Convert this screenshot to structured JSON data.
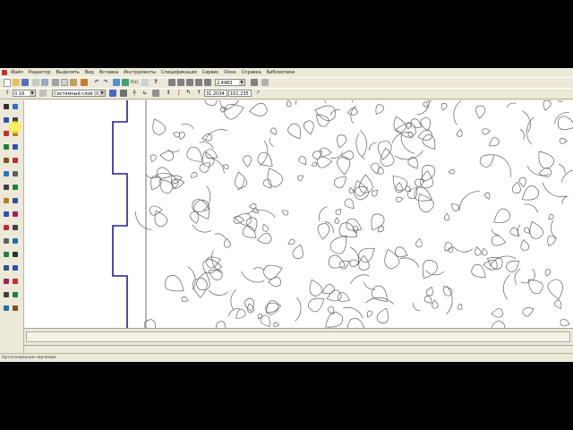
{
  "menu": {
    "items": [
      "Файл",
      "Редактор",
      "Выделить",
      "Вид",
      "Вставка",
      "Инструменты",
      "Спецификация",
      "Сервис",
      "Окно",
      "Справка",
      "Библиотеки"
    ]
  },
  "toolbar1": {
    "zoom_value": "2.4483"
  },
  "toolbar2": {
    "line_width": "0.18",
    "layer": "Системный слой (0)",
    "coord_x": "31.2034",
    "coord_y": "101.235"
  },
  "status": {
    "text": "Ортогональное черчение"
  },
  "colors": {
    "window_bg": "#ece9d8",
    "canvas_bg": "#ffffff",
    "contour_stroke": "#20208a",
    "pattern_stroke": "#606060",
    "highlight": "#fff03c"
  },
  "icons": {
    "left_toolbar": [
      "pointer-icon",
      "line-icon",
      "circle-icon",
      "arc-icon",
      "rect-icon",
      "polygon-icon",
      "spline-icon",
      "hatch-icon",
      "dimension-icon",
      "text-icon",
      "table-icon",
      "select-icon",
      "edit-icon",
      "param-icon",
      "measure-icon",
      "library-icon"
    ]
  }
}
